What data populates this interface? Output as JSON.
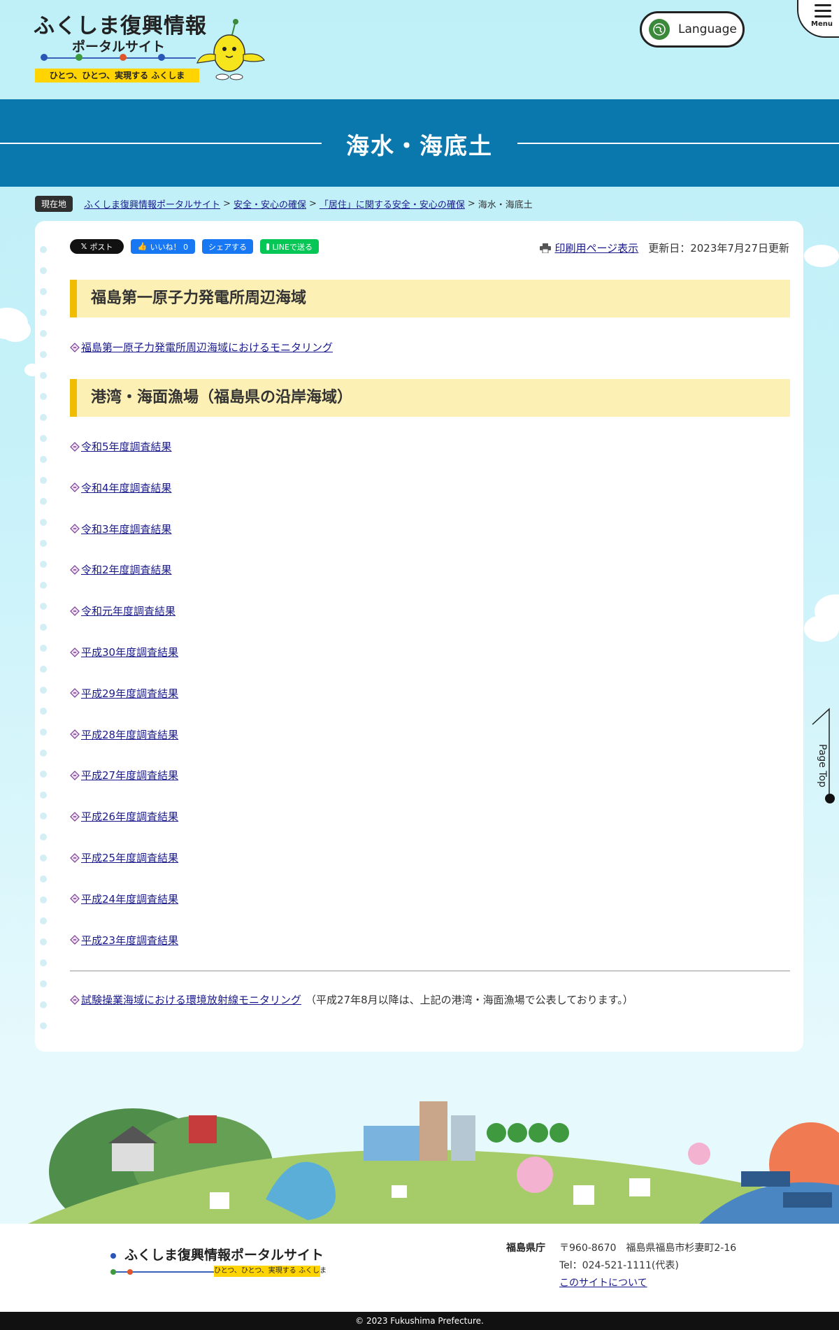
{
  "header": {
    "logo_title": "ふくしま復興情報",
    "logo_sub": "ポータルサイト",
    "logo_tagline": "ひとつ、ひとつ、実現する ふくしま",
    "language_label": "Language",
    "menu_label": "Menu"
  },
  "page": {
    "title": "海水・海底土"
  },
  "breadcrumb": {
    "badge": "現在地",
    "items": [
      "ふくしま復興情報ポータルサイト",
      "安全・安心の確保",
      "「居住」に関する安全・安心の確保"
    ],
    "separator": ">",
    "current": "海水・海底土"
  },
  "share": {
    "x_label": "ポスト",
    "fb_like_label": "いいね！ 0",
    "fb_share_label": "シェアする",
    "line_label": "LINEで送る"
  },
  "meta": {
    "print_label": "印刷用ページ表示",
    "updated": "更新日：2023年7月27日更新"
  },
  "sections": [
    {
      "heading": "福島第一原子力発電所周辺海域",
      "links": [
        "福島第一原子力発電所周辺海域におけるモニタリング"
      ]
    },
    {
      "heading": "港湾・海面漁場（福島県の沿岸海域）",
      "links": [
        "令和5年度調査結果",
        "令和4年度調査結果",
        "令和3年度調査結果",
        "令和2年度調査結果",
        "令和元年度調査結果",
        "平成30年度調査結果",
        "平成29年度調査結果",
        "平成28年度調査結果",
        "平成27年度調査結果",
        "平成26年度調査結果",
        "平成25年度調査結果",
        "平成24年度調査結果",
        "平成23年度調査結果"
      ]
    }
  ],
  "extra_link": {
    "label": "試験操業海域における環境放射線モニタリング",
    "note": "（平成27年8月以降は、上記の港湾・海面漁場で公表しております。）"
  },
  "pagetop_label": "Page Top",
  "footer": {
    "logo_title": "ふくしま復興情報ポータルサイト",
    "logo_tagline": "ひとつ、ひとつ、実現する ふくしま",
    "org": "福島県庁",
    "address": "〒960-8670　福島県福島市杉妻町2-16",
    "tel": "Tel：024-521-1111(代表)",
    "about_link": "このサイトについて",
    "copyright": "© 2023 Fukushima Prefecture."
  },
  "colors": {
    "title_band": "#0a78ad",
    "heading_bg": "#fdf0b4",
    "heading_accent": "#f0bd00",
    "link": "#1a1a8c",
    "tagline_bg": "#ffd400"
  }
}
